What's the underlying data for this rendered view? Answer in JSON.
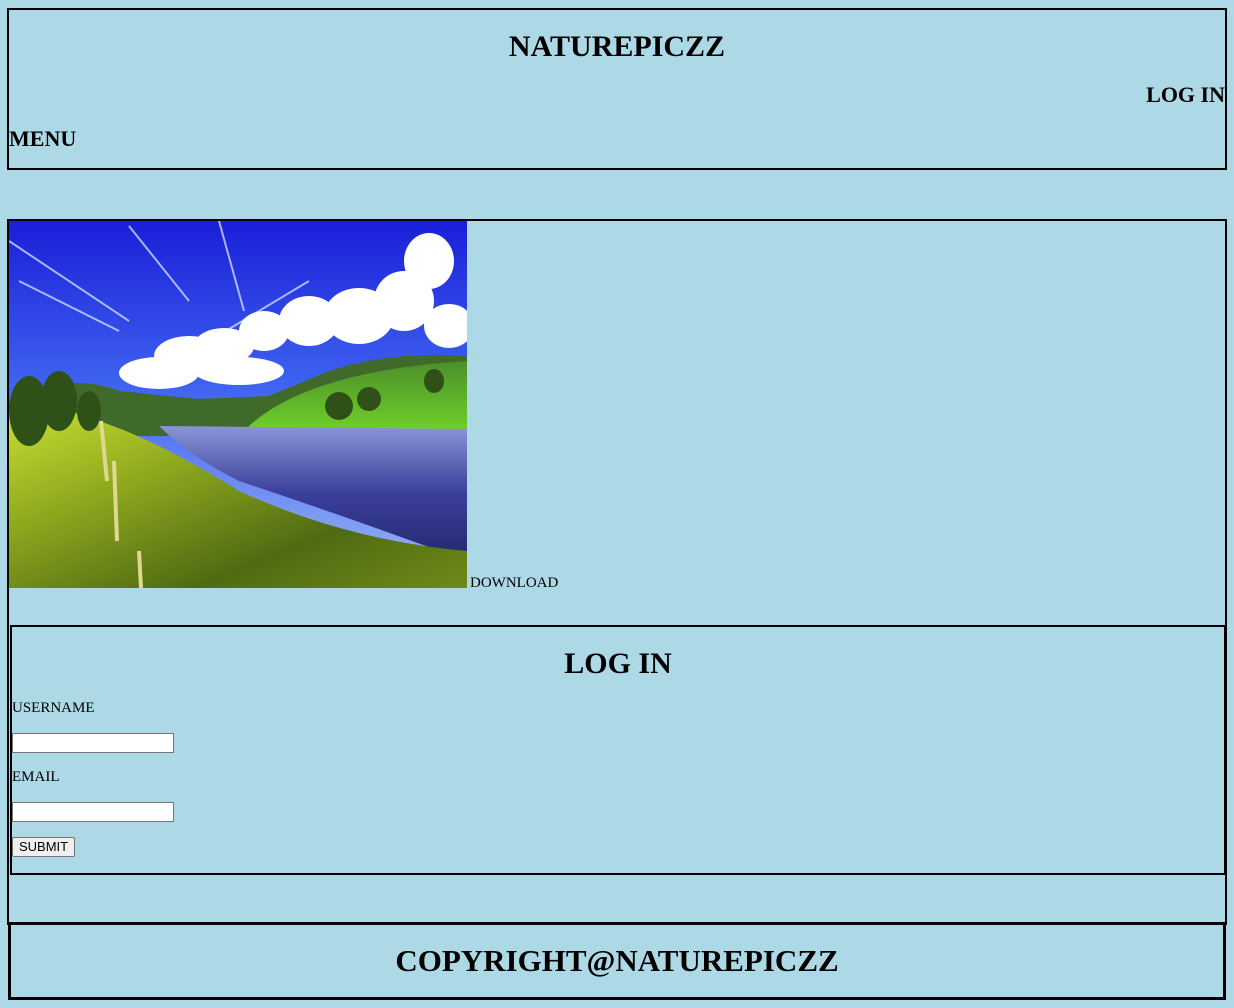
{
  "header": {
    "site_title": "NATUREPICZZ",
    "login_link": "LOG IN",
    "menu_link": "MENU"
  },
  "gallery": {
    "image_name": "landscape-photo",
    "download_link": "DOWNLOAD"
  },
  "login_form": {
    "heading": "LOG IN",
    "username_label": "USERNAME",
    "username_value": "",
    "email_label": "EMAIL",
    "email_value": "",
    "submit_label": "SUBMIT"
  },
  "footer": {
    "copyright": "COPYRIGHT@NATUREPICZZ"
  },
  "colors": {
    "page_background": "#add8e6",
    "border": "#000000"
  }
}
